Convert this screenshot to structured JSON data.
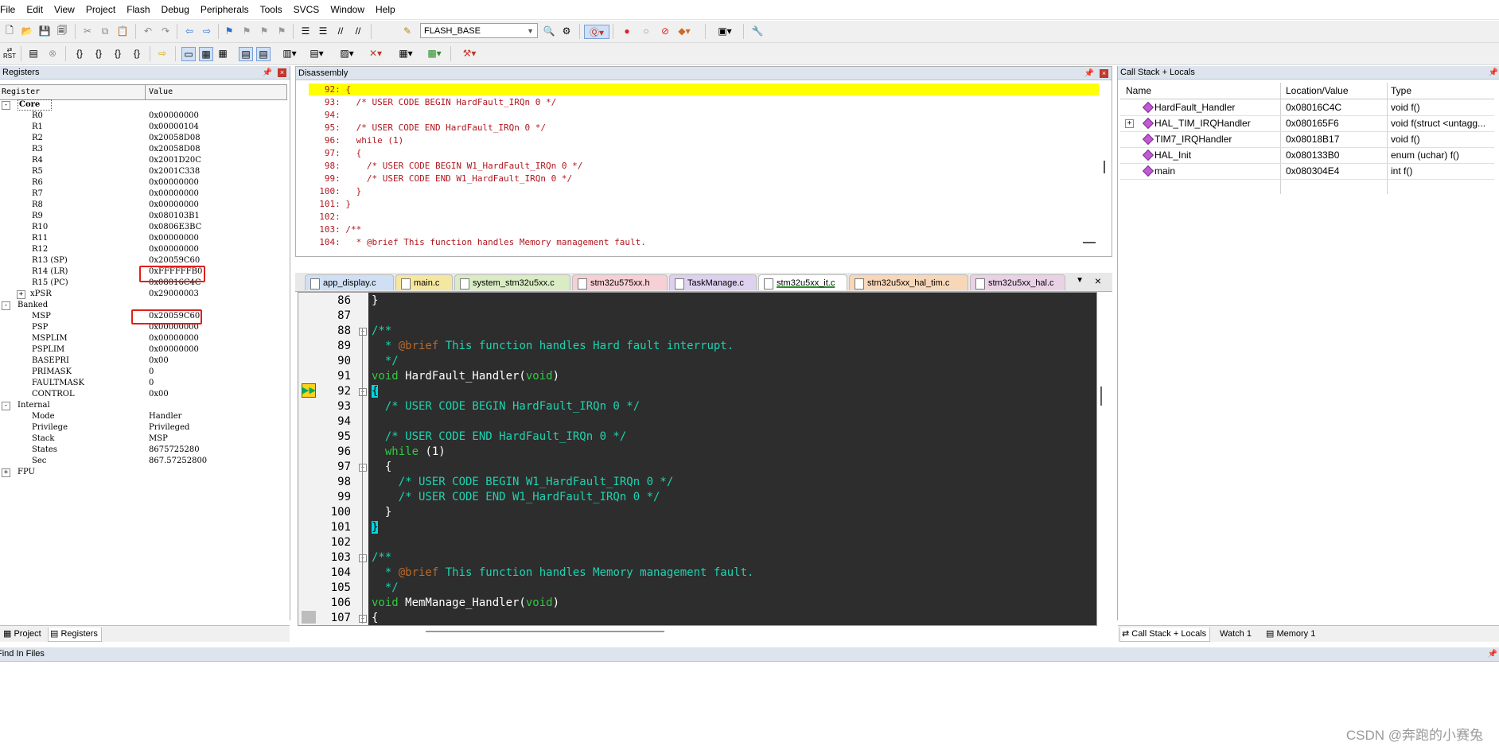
{
  "menu": [
    "File",
    "Edit",
    "View",
    "Project",
    "Flash",
    "Debug",
    "Peripherals",
    "Tools",
    "SVCS",
    "Window",
    "Help"
  ],
  "toolbar": {
    "target": "FLASH_BASE",
    "rst_label": "RST"
  },
  "registers": {
    "title": "Registers",
    "col_register": "Register",
    "col_value": "Value",
    "rows": [
      {
        "level": 0,
        "toggle": "-",
        "name": "Core",
        "value": ""
      },
      {
        "level": 2,
        "name": "R0",
        "value": "0x00000000"
      },
      {
        "level": 2,
        "name": "R1",
        "value": "0x00000104"
      },
      {
        "level": 2,
        "name": "R2",
        "value": "0x20058D08"
      },
      {
        "level": 2,
        "name": "R3",
        "value": "0x20058D08"
      },
      {
        "level": 2,
        "name": "R4",
        "value": "0x2001D20C"
      },
      {
        "level": 2,
        "name": "R5",
        "value": "0x2001C338"
      },
      {
        "level": 2,
        "name": "R6",
        "value": "0x00000000"
      },
      {
        "level": 2,
        "name": "R7",
        "value": "0x00000000"
      },
      {
        "level": 2,
        "name": "R8",
        "value": "0x00000000"
      },
      {
        "level": 2,
        "name": "R9",
        "value": "0x080103B1"
      },
      {
        "level": 2,
        "name": "R10",
        "value": "0x0806E3BC"
      },
      {
        "level": 2,
        "name": "R11",
        "value": "0x00000000"
      },
      {
        "level": 2,
        "name": "R12",
        "value": "0x00000000"
      },
      {
        "level": 2,
        "name": "R13 (SP)",
        "value": "0x20059C60"
      },
      {
        "level": 2,
        "name": "R14 (LR)",
        "value": "0xFFFFFFB0"
      },
      {
        "level": 2,
        "name": "R15 (PC)",
        "value": "0x08016C4C"
      },
      {
        "level": 1,
        "toggle": "+",
        "name": "xPSR",
        "value": "0x29000003"
      },
      {
        "level": 0,
        "toggle": "-",
        "name": "Banked",
        "value": ""
      },
      {
        "level": 2,
        "name": "MSP",
        "value": "0x20059C60"
      },
      {
        "level": 2,
        "name": "PSP",
        "value": "0x00000000"
      },
      {
        "level": 2,
        "name": "MSPLIM",
        "value": "0x00000000"
      },
      {
        "level": 2,
        "name": "PSPLIM",
        "value": "0x00000000"
      },
      {
        "level": 2,
        "name": "BASEPRI",
        "value": "0x00"
      },
      {
        "level": 2,
        "name": "PRIMASK",
        "value": "0"
      },
      {
        "level": 2,
        "name": "FAULTMASK",
        "value": "0"
      },
      {
        "level": 2,
        "name": "CONTROL",
        "value": "0x00"
      },
      {
        "level": 0,
        "toggle": "-",
        "name": "Internal",
        "value": ""
      },
      {
        "level": 2,
        "name": "Mode",
        "value": "Handler"
      },
      {
        "level": 2,
        "name": "Privilege",
        "value": "Privileged"
      },
      {
        "level": 2,
        "name": "Stack",
        "value": "MSP"
      },
      {
        "level": 2,
        "name": "States",
        "value": "8675725280"
      },
      {
        "level": 2,
        "name": "Sec",
        "value": "867.57252800"
      },
      {
        "level": 0,
        "toggle": "+",
        "name": "FPU",
        "value": ""
      }
    ],
    "tab_project": "Project",
    "tab_registers": "Registers"
  },
  "disassembly": {
    "title": "Disassembly",
    "lines": [
      "   92: {",
      "   93:   /* USER CODE BEGIN HardFault_IRQn 0 */",
      "   94: ",
      "   95:   /* USER CODE END HardFault_IRQn 0 */",
      "   96:   while (1)",
      "   97:   {",
      "   98:     /* USER CODE BEGIN W1_HardFault_IRQn 0 */",
      "   99:     /* USER CODE END W1_HardFault_IRQn 0 */",
      "  100:   }",
      "  101: }",
      "  102: ",
      "  103: /**",
      "  104:   * @brief This function handles Memory management fault."
    ]
  },
  "file_tabs": [
    {
      "name": "app_display.c",
      "color": "#cfe0f4",
      "active": false
    },
    {
      "name": "main.c",
      "color": "#f6e7a0",
      "active": false
    },
    {
      "name": "system_stm32u5xx.c",
      "color": "#d9ecc4",
      "active": false
    },
    {
      "name": "stm32u575xx.h",
      "color": "#f7d0d5",
      "active": false
    },
    {
      "name": "TaskManage.c",
      "color": "#ded1ef",
      "active": false
    },
    {
      "name": "stm32u5xx_it.c",
      "color": "#c6dede",
      "active": true
    },
    {
      "name": "stm32u5xx_hal_tim.c",
      "color": "#f8d7b9",
      "active": false
    },
    {
      "name": "stm32u5xx_hal.c",
      "color": "#ead2e6",
      "active": false
    }
  ],
  "editor": {
    "lines": [
      {
        "n": "86",
        "fold": "",
        "segs": [
          [
            "}",
            "cw"
          ]
        ]
      },
      {
        "n": "87",
        "fold": "",
        "segs": []
      },
      {
        "n": "88",
        "fold": "-",
        "segs": [
          [
            "/**",
            "cc"
          ]
        ]
      },
      {
        "n": "89",
        "fold": "",
        "segs": [
          [
            "  * ",
            "cc"
          ],
          [
            "@brief",
            "cb"
          ],
          [
            " This function handles Hard fault interrupt.",
            "cc"
          ]
        ]
      },
      {
        "n": "90",
        "fold": "",
        "segs": [
          [
            "  */",
            "cc"
          ]
        ]
      },
      {
        "n": "91",
        "fold": "",
        "segs": [
          [
            "void",
            "ck"
          ],
          [
            " HardFault_Handler(",
            "cw"
          ],
          [
            "void",
            "ck"
          ],
          [
            ")",
            "cw"
          ]
        ]
      },
      {
        "n": "92",
        "fold": "-",
        "segs": [
          [
            "{",
            "brk"
          ]
        ]
      },
      {
        "n": "93",
        "fold": "",
        "segs": [
          [
            "  /* USER CODE BEGIN HardFault_IRQn 0 */",
            "cc"
          ]
        ]
      },
      {
        "n": "94",
        "fold": "",
        "segs": []
      },
      {
        "n": "95",
        "fold": "",
        "segs": [
          [
            "  /* USER CODE END HardFault_IRQn 0 */",
            "cc"
          ]
        ]
      },
      {
        "n": "96",
        "fold": "",
        "segs": [
          [
            "  while",
            "ck"
          ],
          [
            " (1)",
            "cw"
          ]
        ]
      },
      {
        "n": "97",
        "fold": "-",
        "segs": [
          [
            "  {",
            "cw"
          ]
        ]
      },
      {
        "n": "98",
        "fold": "",
        "segs": [
          [
            "    /* USER CODE BEGIN W1_HardFault_IRQn 0 */",
            "cc"
          ]
        ]
      },
      {
        "n": "99",
        "fold": "",
        "segs": [
          [
            "    /* USER CODE END W1_HardFault_IRQn 0 */",
            "cc"
          ]
        ]
      },
      {
        "n": "100",
        "fold": "",
        "segs": [
          [
            "  }",
            "cw"
          ]
        ]
      },
      {
        "n": "101",
        "fold": "",
        "segs": [
          [
            "}",
            "brk"
          ]
        ]
      },
      {
        "n": "102",
        "fold": "",
        "segs": []
      },
      {
        "n": "103",
        "fold": "-",
        "segs": [
          [
            "/**",
            "cc"
          ]
        ]
      },
      {
        "n": "104",
        "fold": "",
        "segs": [
          [
            "  * ",
            "cc"
          ],
          [
            "@brief",
            "cb"
          ],
          [
            " This function handles Memory management fault.",
            "cc"
          ]
        ]
      },
      {
        "n": "105",
        "fold": "",
        "segs": [
          [
            "  */",
            "cc"
          ]
        ]
      },
      {
        "n": "106",
        "fold": "",
        "segs": [
          [
            "void",
            "ck"
          ],
          [
            " MemManage_Handler(",
            "cw"
          ],
          [
            "void",
            "ck"
          ],
          [
            ")",
            "cw"
          ]
        ]
      },
      {
        "n": "107",
        "fold": "-",
        "segs": [
          [
            "{",
            "cw"
          ]
        ]
      }
    ]
  },
  "callstack": {
    "title": "Call Stack + Locals",
    "col_name": "Name",
    "col_location": "Location/Value",
    "col_type": "Type",
    "rows": [
      {
        "name": "HardFault_Handler",
        "location": "0x08016C4C",
        "type": "void f()",
        "expand": ""
      },
      {
        "name": "HAL_TIM_IRQHandler",
        "location": "0x080165F6",
        "type": "void f(struct <untagg...",
        "expand": "+"
      },
      {
        "name": "TIM7_IRQHandler",
        "location": "0x08018B17",
        "type": "void f()",
        "expand": ""
      },
      {
        "name": "HAL_Init",
        "location": "0x080133B0",
        "type": "enum (uchar) f()",
        "expand": ""
      },
      {
        "name": "main",
        "location": "0x080304E4",
        "type": "int f()",
        "expand": ""
      }
    ],
    "tab_callstack": "Call Stack + Locals",
    "tab_watch": "Watch 1",
    "tab_memory": "Memory 1"
  },
  "find": {
    "title": "Find In Files"
  },
  "watermark": "CSDN @奔跑的小赛兔",
  "colors": {
    "disasm_highlight": "#ffff00",
    "code_bg": "#2d2d2d",
    "comment": "#1fd3b0",
    "keyword": "#2ecc40",
    "doc_tag": "#b86a2c",
    "redbox": "#e0201a"
  }
}
